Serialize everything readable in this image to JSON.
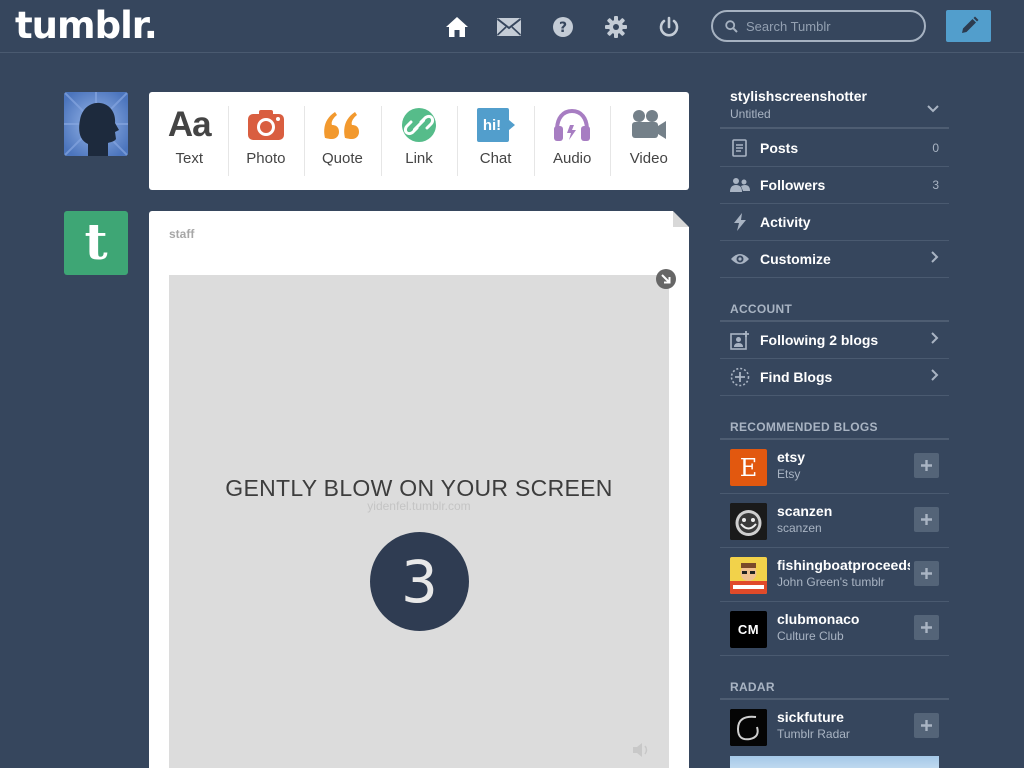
{
  "header": {
    "logo": "tumblr.",
    "search_placeholder": "Search Tumblr",
    "nav": [
      "home-icon",
      "mail-icon",
      "help-icon",
      "settings-icon",
      "power-icon"
    ]
  },
  "post_types": [
    {
      "label": "Text",
      "icon": "text-icon",
      "color": "#444444"
    },
    {
      "label": "Photo",
      "icon": "camera-icon",
      "color": "#d95e40"
    },
    {
      "label": "Quote",
      "icon": "quote-icon",
      "color": "#f2992e"
    },
    {
      "label": "Link",
      "icon": "link-icon",
      "color": "#56bc8a"
    },
    {
      "label": "Chat",
      "icon": "chat-icon",
      "color": "#529ecc",
      "badge": "hi!"
    },
    {
      "label": "Audio",
      "icon": "headphones-icon",
      "color": "#a77dc2"
    },
    {
      "label": "Video",
      "icon": "video-camera-icon",
      "color": "#748089"
    }
  ],
  "post": {
    "author": "staff",
    "gif_text": "GENTLY BLOW ON YOUR SCREEN",
    "gif_subtext": "yidenfel.tumblr.com",
    "countdown": "3"
  },
  "sidebar": {
    "blog_name": "stylishscreenshotter",
    "blog_subtitle": "Untitled",
    "items": [
      {
        "label": "Posts",
        "count": "0",
        "icon": "posts-icon"
      },
      {
        "label": "Followers",
        "count": "3",
        "icon": "followers-icon"
      },
      {
        "label": "Activity",
        "count": "",
        "icon": "activity-icon"
      },
      {
        "label": "Customize",
        "count": "",
        "icon": "eye-icon"
      }
    ],
    "account_heading": "ACCOUNT",
    "account_items": [
      {
        "label": "Following 2 blogs",
        "icon": "following-icon"
      },
      {
        "label": "Find Blogs",
        "icon": "find-blogs-icon"
      }
    ],
    "recommended_heading": "RECOMMENDED BLOGS",
    "recommended": [
      {
        "name": "etsy",
        "subtitle": "Etsy",
        "avatar_text": "E",
        "avatar_bg": "#e2580f"
      },
      {
        "name": "scanzen",
        "subtitle": "scanzen",
        "avatar_text": "",
        "avatar_bg": "#111111"
      },
      {
        "name": "fishingboatproceeds",
        "subtitle": "John Green's tumblr",
        "avatar_text": "",
        "avatar_bg": "#e04a2a"
      },
      {
        "name": "clubmonaco",
        "subtitle": "Culture Club",
        "avatar_text": "CM",
        "avatar_bg": "#000000"
      }
    ],
    "radar_heading": "RADAR",
    "radar": {
      "name": "sickfuture",
      "subtitle": "Tumblr Radar"
    }
  },
  "colors": {
    "background": "#36465d",
    "accent": "#529ecc",
    "staff_avatar": "#3ea675"
  }
}
